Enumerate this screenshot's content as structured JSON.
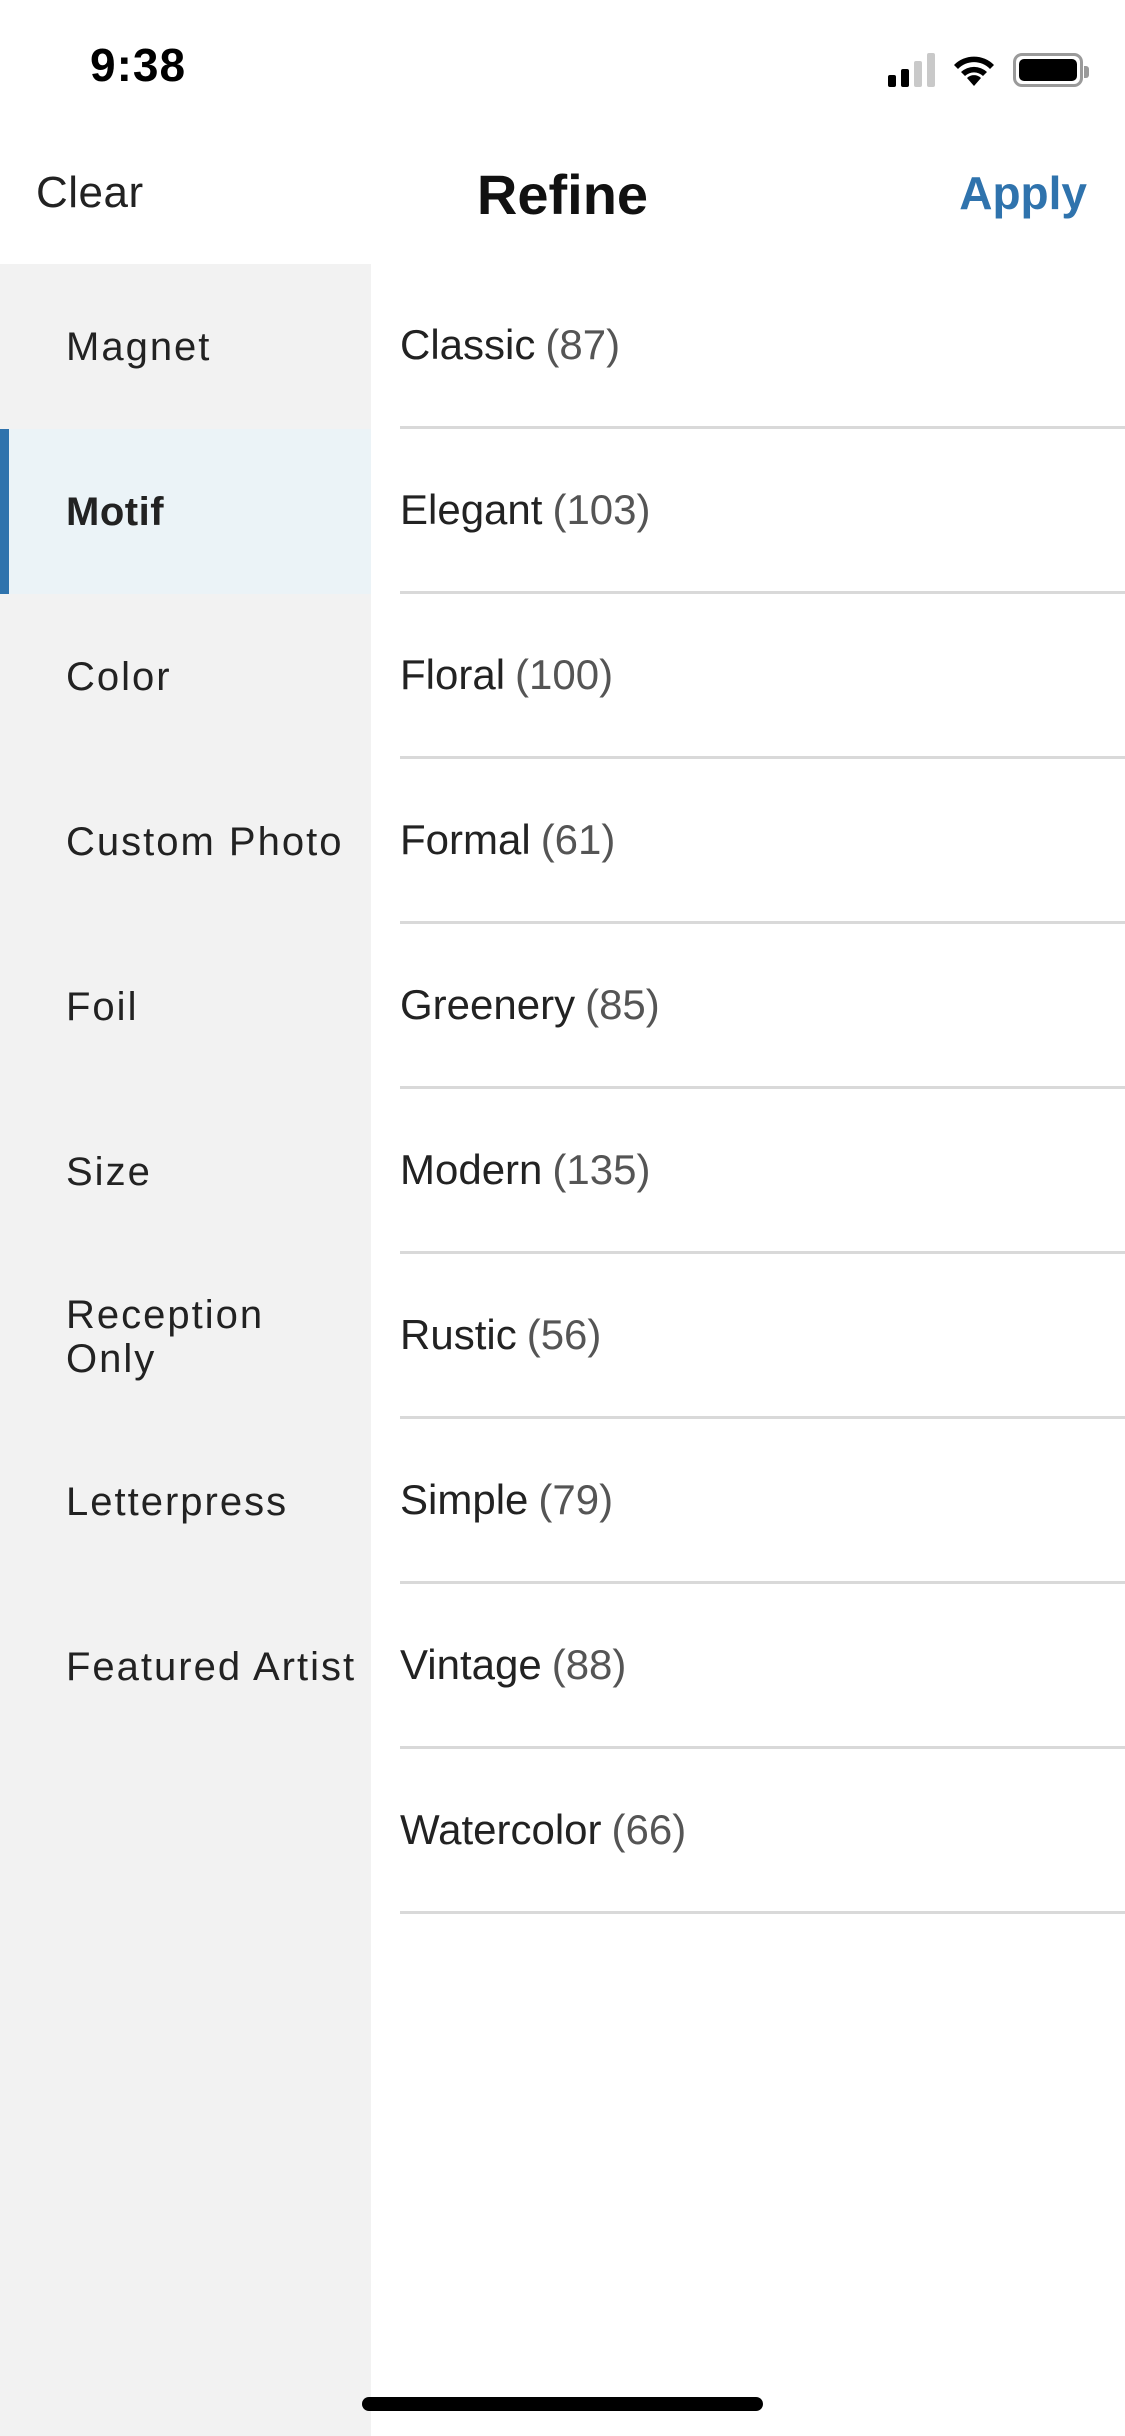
{
  "status_bar": {
    "time": "9:38",
    "icons": [
      "cellular-signal-icon",
      "wifi-icon",
      "battery-icon"
    ]
  },
  "nav": {
    "clear_label": "Clear",
    "title": "Refine",
    "apply_label": "Apply"
  },
  "colors": {
    "accent": "#2f73ad",
    "sidebar_bg": "#f2f2f2",
    "sidebar_active_bg": "#ebf3f7",
    "divider": "#d9d9d9"
  },
  "sidebar": {
    "active_index": 1,
    "items": [
      {
        "label": "Magnet"
      },
      {
        "label": "Motif"
      },
      {
        "label": "Color"
      },
      {
        "label": "Custom Photo"
      },
      {
        "label": "Foil"
      },
      {
        "label": "Size"
      },
      {
        "label": "Reception Only"
      },
      {
        "label": "Letterpress"
      },
      {
        "label": "Featured Artist"
      }
    ]
  },
  "options": {
    "items": [
      {
        "name": "Classic",
        "count": "(87)"
      },
      {
        "name": "Elegant",
        "count": "(103)"
      },
      {
        "name": "Floral",
        "count": "(100)"
      },
      {
        "name": "Formal",
        "count": "(61)"
      },
      {
        "name": "Greenery",
        "count": "(85)"
      },
      {
        "name": "Modern",
        "count": "(135)"
      },
      {
        "name": "Rustic",
        "count": "(56)"
      },
      {
        "name": "Simple",
        "count": "(79)"
      },
      {
        "name": "Vintage",
        "count": "(88)"
      },
      {
        "name": "Watercolor",
        "count": "(66)"
      }
    ]
  }
}
